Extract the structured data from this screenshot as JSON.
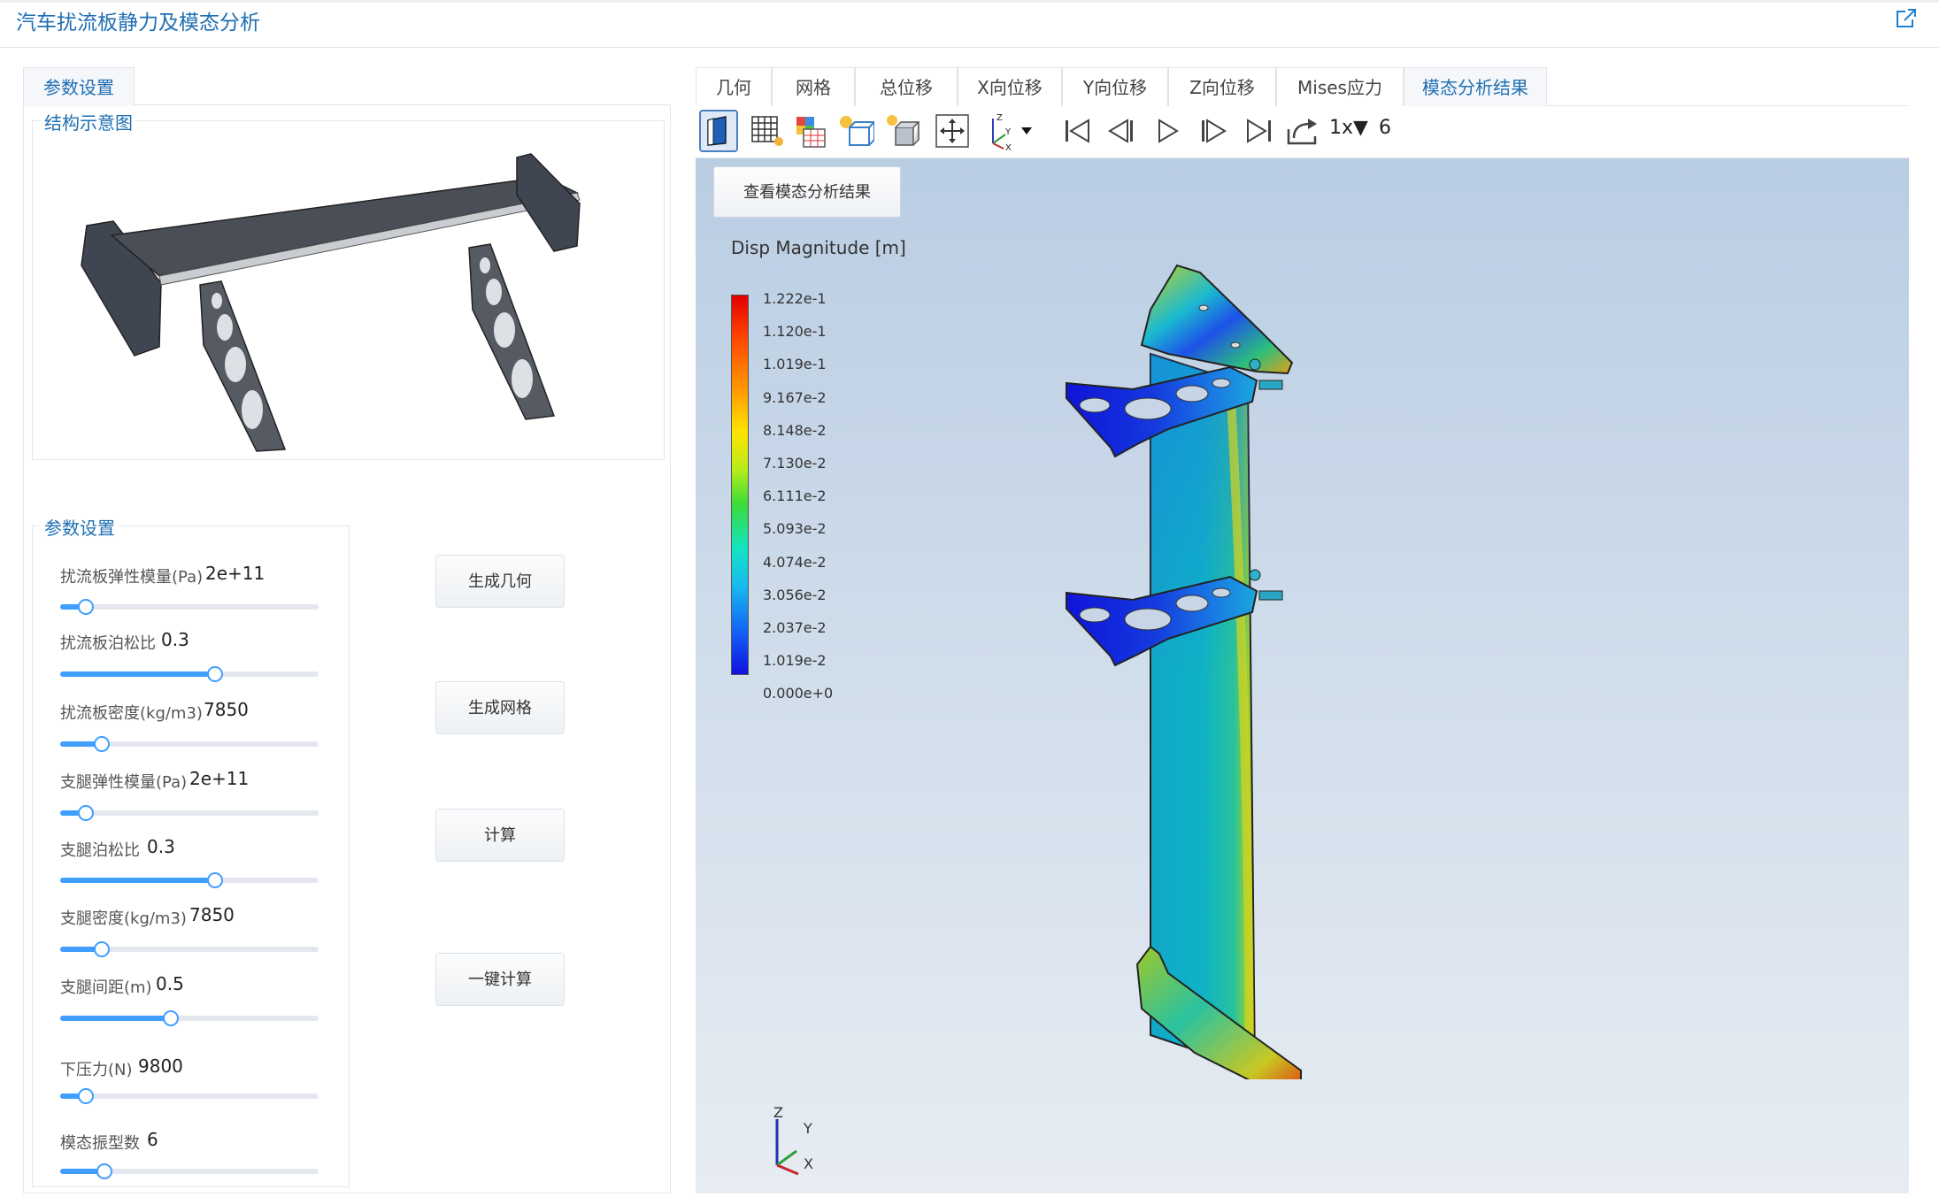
{
  "app": {
    "title": "汽车扰流板静力及模态分析"
  },
  "left": {
    "tab_label": "参数设置",
    "diagram_title": "结构示意图",
    "params_title": "参数设置",
    "params": [
      {
        "label": "扰流板弹性模量(Pa)",
        "value": "2e+11",
        "position": 0.1
      },
      {
        "label": "扰流板泊松比",
        "value": "0.3",
        "position": 0.6
      },
      {
        "label": "扰流板密度(kg/m3)",
        "value": "7850",
        "position": 0.16
      },
      {
        "label": "支腿弹性模量(Pa)",
        "value": "2e+11",
        "position": 0.1
      },
      {
        "label": "支腿泊松比",
        "value": "0.3",
        "position": 0.6
      },
      {
        "label": "支腿密度(kg/m3)",
        "value": "7850",
        "position": 0.16
      },
      {
        "label": "支腿间距(m)",
        "value": "0.5",
        "position": 0.43
      },
      {
        "label": "下压力(N)",
        "value": "9800",
        "position": 0.1
      },
      {
        "label": "模态振型数",
        "value": "6",
        "position": 0.17
      }
    ],
    "buttons": [
      "生成几何",
      "生成网格",
      "计算",
      "一键计算"
    ]
  },
  "right": {
    "tabs": [
      "几何",
      "网格",
      "总位移",
      "X向位移",
      "Y向位移",
      "Z向位移",
      "Mises应力",
      "模态分析结果"
    ],
    "active_tab": "模态分析结果",
    "toolbar": {
      "icons": [
        "surface-view-icon",
        "mesh-view-icon",
        "grid-color-icon",
        "light-edges-icon",
        "wireframe-light-icon",
        "solid-box-icon",
        "fit-view-icon",
        "axes-orientation-icon",
        "first-frame-icon",
        "prev-frame-icon",
        "play-icon",
        "next-frame-icon",
        "last-frame-icon",
        "export-icon"
      ],
      "speed": "1x▼",
      "frame": "6"
    },
    "view_results_button": "查看模态分析结果",
    "legend": {
      "title": "Disp Magnitude [m]",
      "labels": [
        "1.222e-1",
        "1.120e-1",
        "1.019e-1",
        "9.167e-2",
        "8.148e-2",
        "7.130e-2",
        "6.111e-2",
        "5.093e-2",
        "4.074e-2",
        "3.056e-2",
        "2.037e-2",
        "1.019e-2",
        "0.000e+0"
      ]
    },
    "axes": {
      "z": "Z",
      "y": "Y",
      "x": "X"
    }
  }
}
